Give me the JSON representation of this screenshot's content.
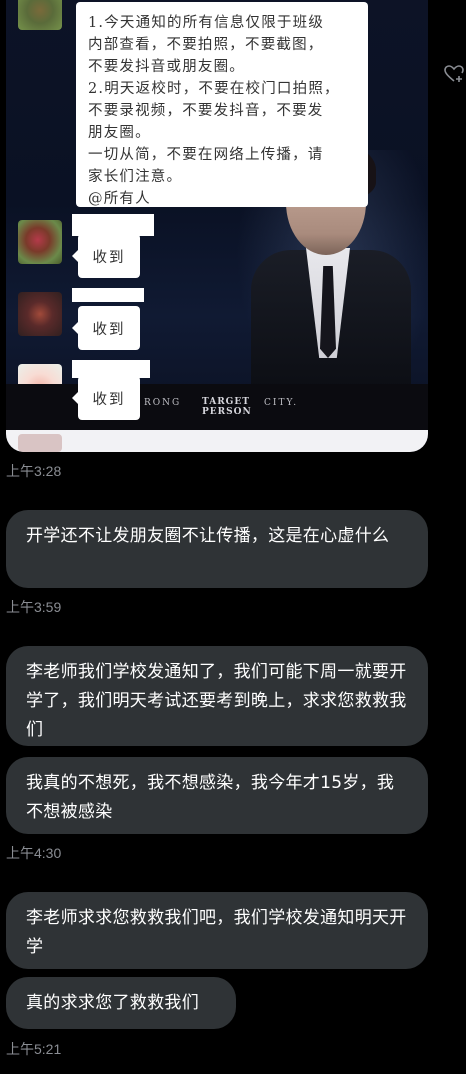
{
  "image": {
    "notice_lines": [
      "1.今天通知的所有信息仅限于班级",
      "内部查看，不要拍照，不要截图，",
      "不要发抖音或朋友圈。",
      "2.明天返校时，不要在校门口拍照，",
      "不要录视频，不要发抖音，不要发",
      "朋友圈。",
      "一切从简，不要在网络上传播，请",
      "家长们注意。",
      "@所有人"
    ],
    "replies": [
      "收到",
      "收到",
      "收到"
    ],
    "footer_left": "RONG",
    "footer_target": "TARGET",
    "footer_person": "PERSON",
    "footer_right": "CITY."
  },
  "messages": [
    {
      "time": "上午3:28"
    },
    {
      "text": "开学还不让发朋友圈不让传播，这是在心虚什么",
      "time": "上午3:59"
    },
    {
      "text": "李老师我们学校发通知了，我们可能下周一就要开学了，我们明天考试还要考到晚上，求求您救救我们"
    },
    {
      "text": "我真的不想死，我不想感染，我今年才15岁，我不想被感染",
      "time": "上午4:30"
    },
    {
      "text": "李老师求求您救救我们吧，我们学校发通知明天开学"
    },
    {
      "text": "真的求求您了救救我们",
      "time": "上午5:21"
    }
  ],
  "icons": {
    "like": "heart-plus-icon"
  }
}
